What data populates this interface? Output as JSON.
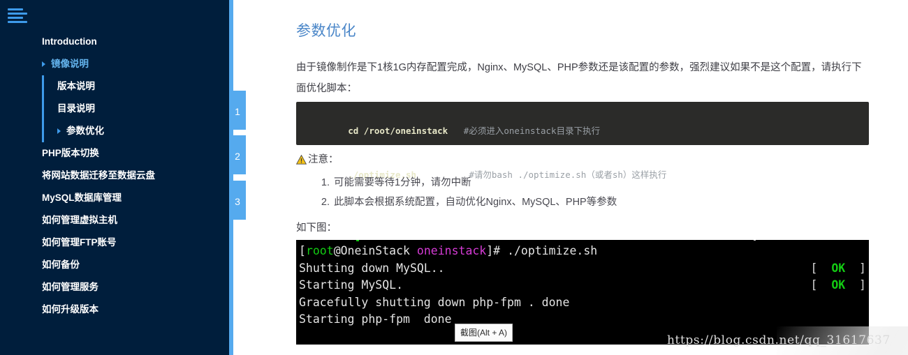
{
  "sidebar": {
    "menu_icon": "hamburger-icon",
    "items": [
      {
        "label": "Introduction",
        "level": 0,
        "caret": false,
        "active": false
      },
      {
        "label": "镜像说明",
        "level": 0,
        "caret": true,
        "active": true
      },
      {
        "label": "版本说明",
        "level": 1,
        "caret": false,
        "active": false
      },
      {
        "label": "目录说明",
        "level": 1,
        "caret": false,
        "active": false
      },
      {
        "label": "参数优化",
        "level": 1,
        "caret": true,
        "active": false
      },
      {
        "label": "PHP版本切换",
        "level": 0,
        "caret": false,
        "active": false
      },
      {
        "label": "将网站数据迁移至数据云盘",
        "level": 0,
        "caret": false,
        "active": false
      },
      {
        "label": "MySQL数据库管理",
        "level": 0,
        "caret": false,
        "active": false
      },
      {
        "label": "如何管理虚拟主机",
        "level": 0,
        "caret": false,
        "active": false
      },
      {
        "label": "如何管理FTP账号",
        "level": 0,
        "caret": false,
        "active": false
      },
      {
        "label": "如何备份",
        "level": 0,
        "caret": false,
        "active": false
      },
      {
        "label": "如何管理服务",
        "level": 0,
        "caret": false,
        "active": false
      },
      {
        "label": "如何升级版本",
        "level": 0,
        "caret": false,
        "active": false
      }
    ],
    "background_color": "#001e3c",
    "accent_color": "#3e9bea"
  },
  "steps": {
    "accent_color": "#55aaee",
    "items": [
      {
        "number": "1"
      },
      {
        "number": "2"
      },
      {
        "number": "3"
      }
    ]
  },
  "main": {
    "title": "参数优化",
    "paragraph": "由于镜像制作是下1核1G内存配置完成，Nginx、MySQL、PHP参数还是该配置的参数，强烈建议如果不是这个配置，请执行下面优化脚本：",
    "code_block": {
      "background_color": "#2b2b29",
      "lines": [
        {
          "command": "cd /root/oneinstack",
          "comment": "#必须进入oneinstack目录下执行"
        },
        {
          "command": "./optimize.sh",
          "comment": "#请勿bash ./optimize.sh（或者sh）这样执行"
        }
      ]
    },
    "note": {
      "icon": "warning-triangle-icon",
      "heading": "注意：",
      "items": [
        "可能需要等待1分钟，请勿中断",
        "此脚本会根据系统配置，自动优化Nginx、MySQL、PHP等参数"
      ]
    },
    "figure_caption": "如下图：",
    "terminal": {
      "background_color": "#000000",
      "prompt_user": "root",
      "prompt_host": "OneinStack",
      "prompt_dir": "oneinstack",
      "lines": [
        {
          "type": "prompt",
          "bracket_open": "[",
          "user": "root",
          "at": "@",
          "host": "OneinStack",
          "space": " ",
          "dir": "oneinstack",
          "bracket_close": "]# ",
          "command": "./optimize.sh",
          "status": ""
        },
        {
          "type": "output",
          "text": "Shutting down MySQL..",
          "status": "OK"
        },
        {
          "type": "output",
          "text": "Starting MySQL.",
          "status": "OK"
        },
        {
          "type": "output",
          "text": "Gracefully shutting down php-fpm . done",
          "status": ""
        },
        {
          "type": "output",
          "text": "Starting php-fpm  done",
          "status": ""
        }
      ],
      "status_ok_label": "OK",
      "status_color": "#13cd13"
    }
  },
  "tooltip": {
    "label": "截图(Alt + A)"
  },
  "watermark": {
    "text": "https://blog.csdn.net/qq_31617637"
  }
}
